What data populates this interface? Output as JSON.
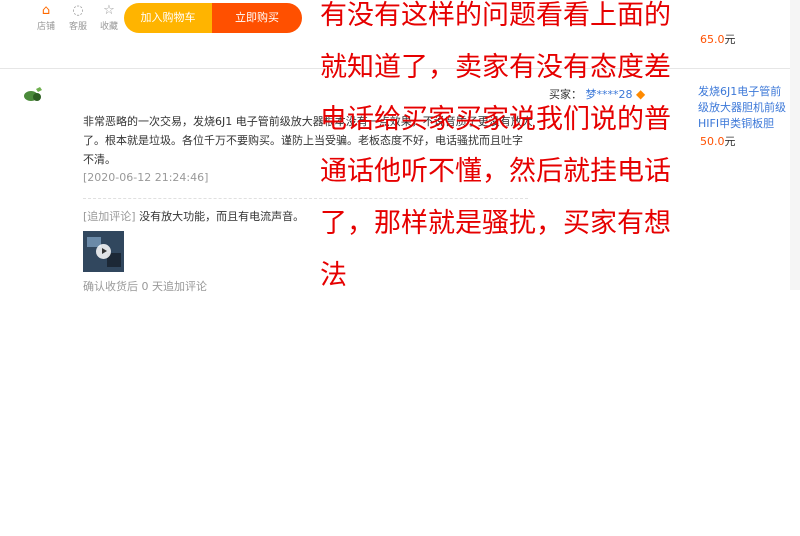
{
  "toolbar": {
    "shop_label": "店铺",
    "service_label": "客服",
    "favorite_label": "收藏",
    "add_to_cart": "加入购物车",
    "buy_now": "立即购买",
    "shop_icon": "shop-icon",
    "service_icon": "chat-icon",
    "favorite_icon": "star-icon"
  },
  "review": {
    "text": "非常恶略的一次交易，发烧6J1 电子管前级放大器根本没有一点效果，不说音质了更没有放大了。根本就是垃圾。各位千万不要购买。谨防上当受骗。老板态度不好，电话骚扰而且吐字不清。",
    "date": "[2020-06-12 21:24:46]",
    "append_tag": "[追加评论]",
    "append_text": "没有放大功能，而且有电流声音。",
    "confirm": "确认收货后 0 天追加评论"
  },
  "buyer": {
    "label": "买家：",
    "nick": "梦****28"
  },
  "products": [
    {
      "price": "65.0",
      "unit": "元"
    },
    {
      "name": "发烧6J1电子管前级放大器胆机前级HIFI甲类铜板胆前...",
      "price": "50.0",
      "unit": "元"
    }
  ],
  "overlay_lines": [
    "有没有这样的问题看看上面的",
    "就知道了，卖家有没有态度差",
    "电话给买家买家说我们说的普",
    "通话他听不懂，然后就挂电话",
    "了，那样就是骚扰，买家有想",
    "法"
  ],
  "colors": {
    "accent": "#ff5000",
    "cart": "#ffb400",
    "link": "#3c78d8",
    "overlay": "#e60000"
  }
}
